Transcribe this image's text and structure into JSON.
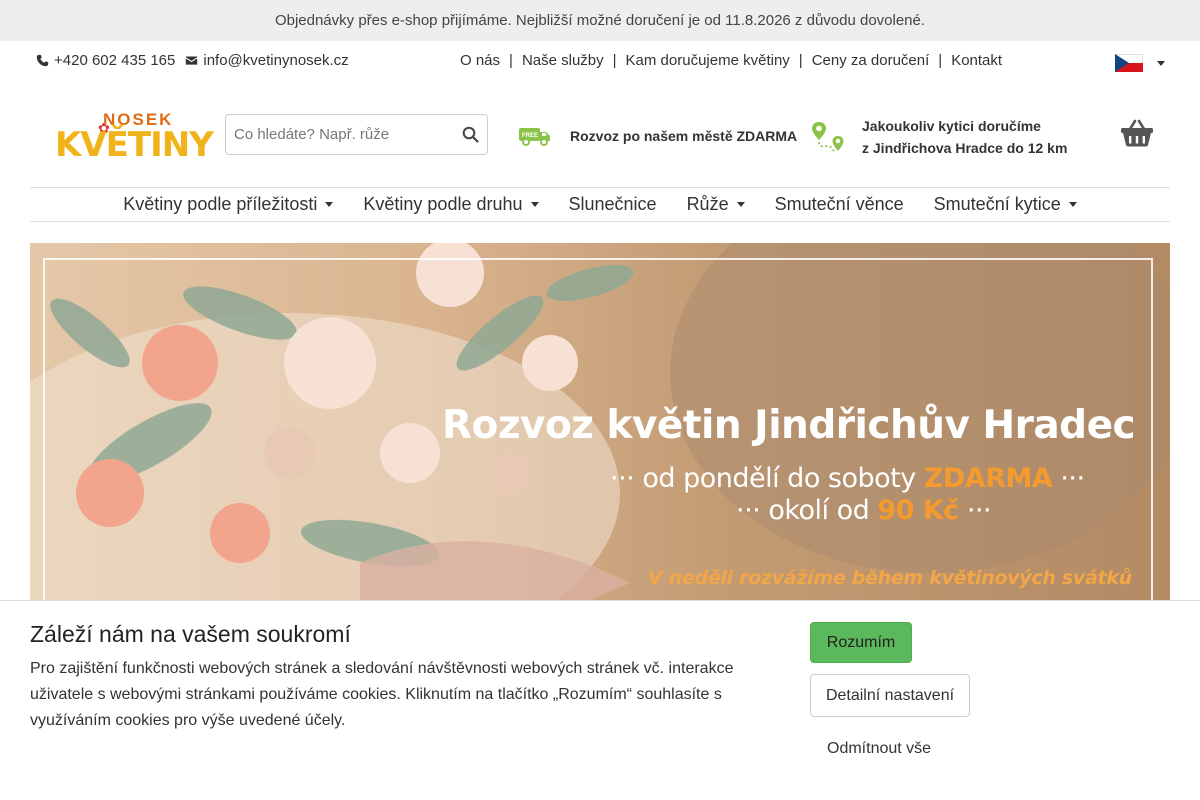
{
  "announcement": "Objednávky přes e-shop přijímáme. Nejbližší možné doručení je od 11.8.2026 z důvodu dovolené.",
  "contact": {
    "phone": "+420 602 435 165",
    "email": "info@kvetinynosek.cz"
  },
  "top_links": [
    "O nás",
    "Naše služby",
    "Kam doručujeme květiny",
    "Ceny za doručení",
    "Kontakt"
  ],
  "top_links_separator": "|",
  "language": {
    "icon": "czech-flag-icon"
  },
  "logo": {
    "top": "NOSEK",
    "bottom": "KVĚTINY"
  },
  "search": {
    "placeholder": "Co hledáte? Např. růže"
  },
  "benefits": {
    "delivery": "Rozvoz po našem městě ZDARMA",
    "delivery_badge": "FREE",
    "range_line1": "Jakoukoliv kytici doručíme",
    "range_line2": "z Jindřichova Hradce do 12 km"
  },
  "nav": [
    {
      "label": "Květiny podle příležitosti",
      "dropdown": true
    },
    {
      "label": "Květiny podle druhu",
      "dropdown": true
    },
    {
      "label": "Slunečnice",
      "dropdown": false
    },
    {
      "label": "Růže",
      "dropdown": true
    },
    {
      "label": "Smuteční věnce",
      "dropdown": false
    },
    {
      "label": "Smuteční kytice",
      "dropdown": true
    }
  ],
  "banner": {
    "title": "Rozvoz květin Jindřichův Hradec",
    "line2_pre": "··· od pondělí do soboty ",
    "line2_highlight": "ZDARMA",
    "line2_post": " ···",
    "line3_pre": "··· okolí od ",
    "line3_highlight": "90 Kč",
    "line3_post": " ···",
    "line4": "V neděli rozvážíme během květinových svátků"
  },
  "cookie": {
    "title": "Záleží nám na vašem soukromí",
    "text": "Pro zajištění funkčnosti webových stránek a sledování návštěvnosti webových stránek vč. interakce uživatele s webovými stránkami používáme cookies. Kliknutím na tlačítko „Rozumím“ souhlasíte s využíváním cookies pro výše uvedené účely.",
    "accept": "Rozumím",
    "details": "Detailní nastavení",
    "reject": "Odmítnout vše"
  },
  "colors": {
    "accent_green": "#5cb85c",
    "logo_yellow": "#f1b31c",
    "banner_orange": "#f59a2e",
    "icon_green": "#8bc34a"
  }
}
